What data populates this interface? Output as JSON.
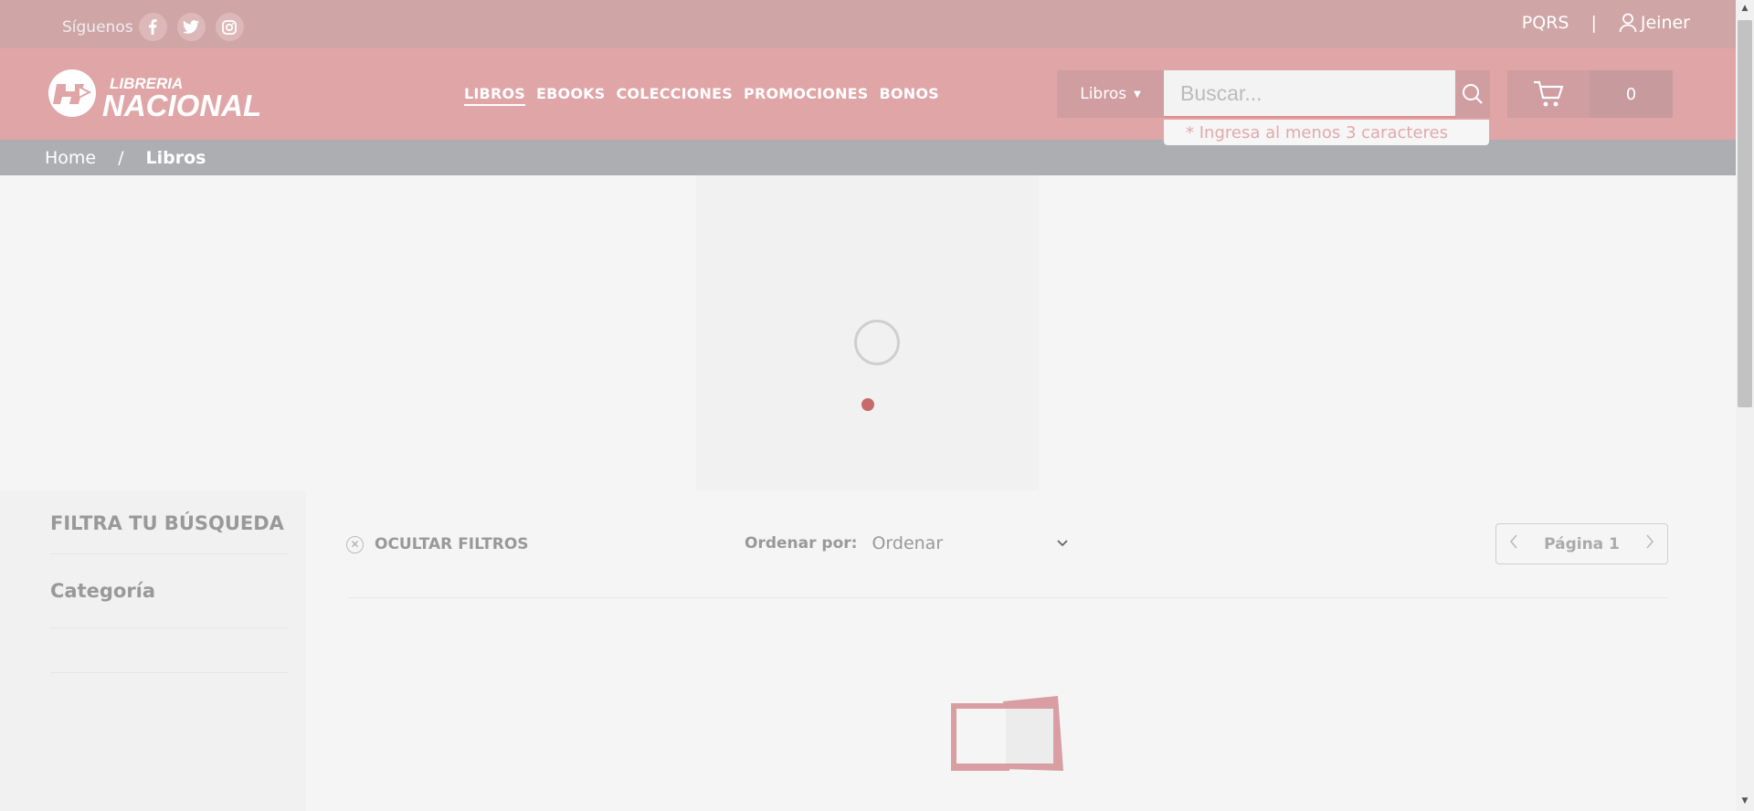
{
  "topbar": {
    "follow_label": "Síguenos",
    "social": [
      {
        "icon": "facebook-icon",
        "glyph": "f"
      },
      {
        "icon": "twitter-icon",
        "glyph": ""
      },
      {
        "icon": "instagram-icon",
        "glyph": ""
      }
    ],
    "pqrs": "PQRS",
    "separator": "|",
    "user_name": "Jeiner"
  },
  "header": {
    "logo_line1": "LIBRERIA",
    "logo_line2": "NACIONAL",
    "nav": [
      "LIBROS",
      "EBOOKS",
      "COLECCIONES",
      "PROMOCIONES",
      "BONOS"
    ],
    "active_nav": "LIBROS",
    "search_category": "Libros",
    "search_placeholder": "Buscar...",
    "search_hint": "* Ingresa al menos 3 caracteres",
    "cart_count": "0"
  },
  "breadcrumb": {
    "home": "Home",
    "separator": "/",
    "current": "Libros"
  },
  "sidebar": {
    "title": "FILTRA TU BÚSQUEDA",
    "category": "Categoría"
  },
  "toolbar": {
    "hide_filters": "OCULTAR FILTROS",
    "sort_label": "Ordenar por:",
    "sort_value": "Ordenar",
    "page_label": "Página 1"
  },
  "colors": {
    "topbar": "#d0a5a6",
    "header": "#e0a5a7",
    "accent": "#c86a6b",
    "breadcrumb": "#acaeb2"
  }
}
